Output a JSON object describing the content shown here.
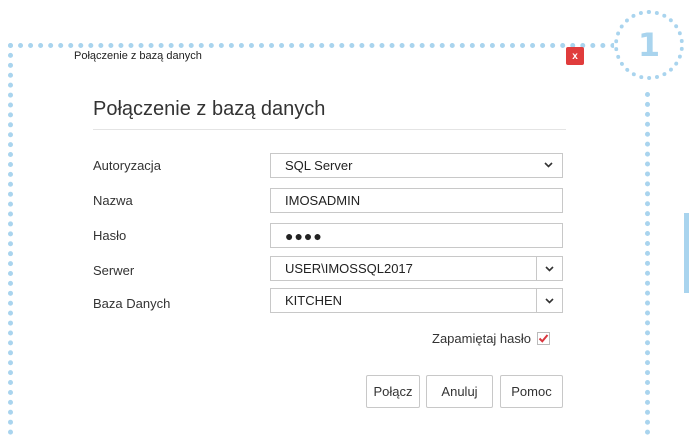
{
  "window": {
    "title": "Połączenie z bazą danych",
    "close_label": "x"
  },
  "callout": {
    "number": "1"
  },
  "dialog": {
    "heading": "Połączenie z bazą danych",
    "fields": {
      "auth": {
        "label": "Autoryzacja",
        "value": "SQL Server"
      },
      "name": {
        "label": "Nazwa",
        "value": "IMOSADMIN"
      },
      "password": {
        "label": "Hasło",
        "value": "●●●●"
      },
      "server": {
        "label": "Serwer",
        "value": "USER\\IMOSSQL2017"
      },
      "database": {
        "label": "Baza Danych",
        "value": "KITCHEN"
      }
    },
    "remember": {
      "label": "Zapamiętaj hasło",
      "checked": true
    },
    "buttons": {
      "connect": "Połącz",
      "cancel": "Anuluj",
      "help": "Pomoc"
    }
  },
  "colors": {
    "accent_dotted": "#a9d4ee",
    "close_red": "#e03c3c",
    "check_red": "#d9363e"
  }
}
